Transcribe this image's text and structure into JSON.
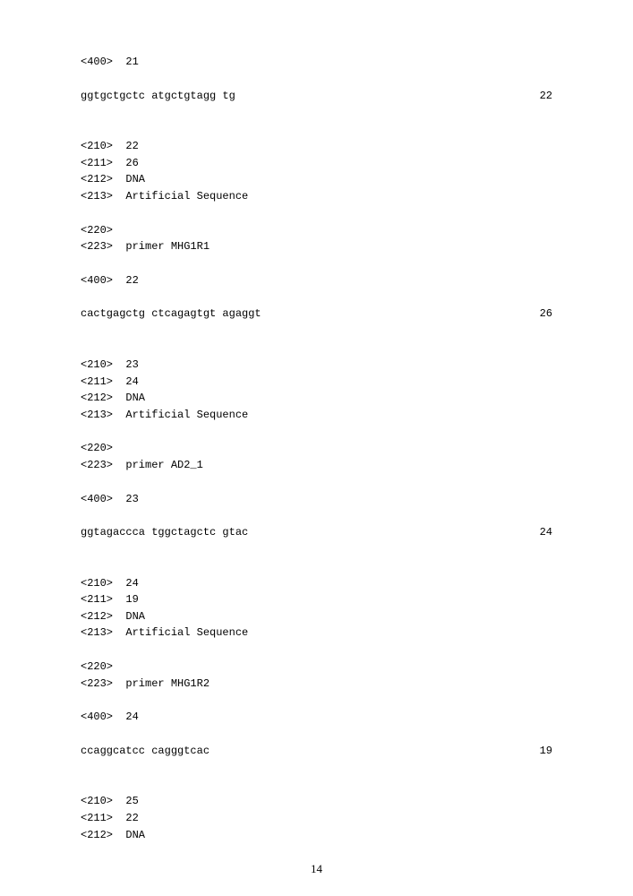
{
  "blocks": [
    {
      "type": "entry",
      "gap": "",
      "lines": [
        "<400>  21"
      ]
    },
    {
      "type": "seq",
      "left": "ggtgctgctc atgctgtagg tg",
      "right": "22",
      "gap": "big"
    },
    {
      "type": "entry",
      "gap": "",
      "lines": [
        "<210>  22",
        "<211>  26",
        "<212>  DNA",
        "<213>  Artificial Sequence"
      ]
    },
    {
      "type": "entry",
      "gap": "",
      "lines": [
        "<220>",
        "<223>  primer MHG1R1"
      ]
    },
    {
      "type": "entry",
      "gap": "",
      "lines": [
        "<400>  22"
      ]
    },
    {
      "type": "seq",
      "left": "cactgagctg ctcagagtgt agaggt",
      "right": "26",
      "gap": "big"
    },
    {
      "type": "entry",
      "gap": "",
      "lines": [
        "<210>  23",
        "<211>  24",
        "<212>  DNA",
        "<213>  Artificial Sequence"
      ]
    },
    {
      "type": "entry",
      "gap": "",
      "lines": [
        "<220>",
        "<223>  primer AD2_1"
      ]
    },
    {
      "type": "entry",
      "gap": "",
      "lines": [
        "<400>  23"
      ]
    },
    {
      "type": "seq",
      "left": "ggtagaccca tggctagctc gtac",
      "right": "24",
      "gap": "big"
    },
    {
      "type": "entry",
      "gap": "",
      "lines": [
        "<210>  24",
        "<211>  19",
        "<212>  DNA",
        "<213>  Artificial Sequence"
      ]
    },
    {
      "type": "entry",
      "gap": "",
      "lines": [
        "<220>",
        "<223>  primer MHG1R2"
      ]
    },
    {
      "type": "entry",
      "gap": "",
      "lines": [
        "<400>  24"
      ]
    },
    {
      "type": "seq",
      "left": "ccaggcatcc cagggtcac",
      "right": "19",
      "gap": "big"
    },
    {
      "type": "entry",
      "gap": "",
      "lines": [
        "<210>  25",
        "<211>  22",
        "<212>  DNA"
      ]
    }
  ],
  "page_number": "14"
}
